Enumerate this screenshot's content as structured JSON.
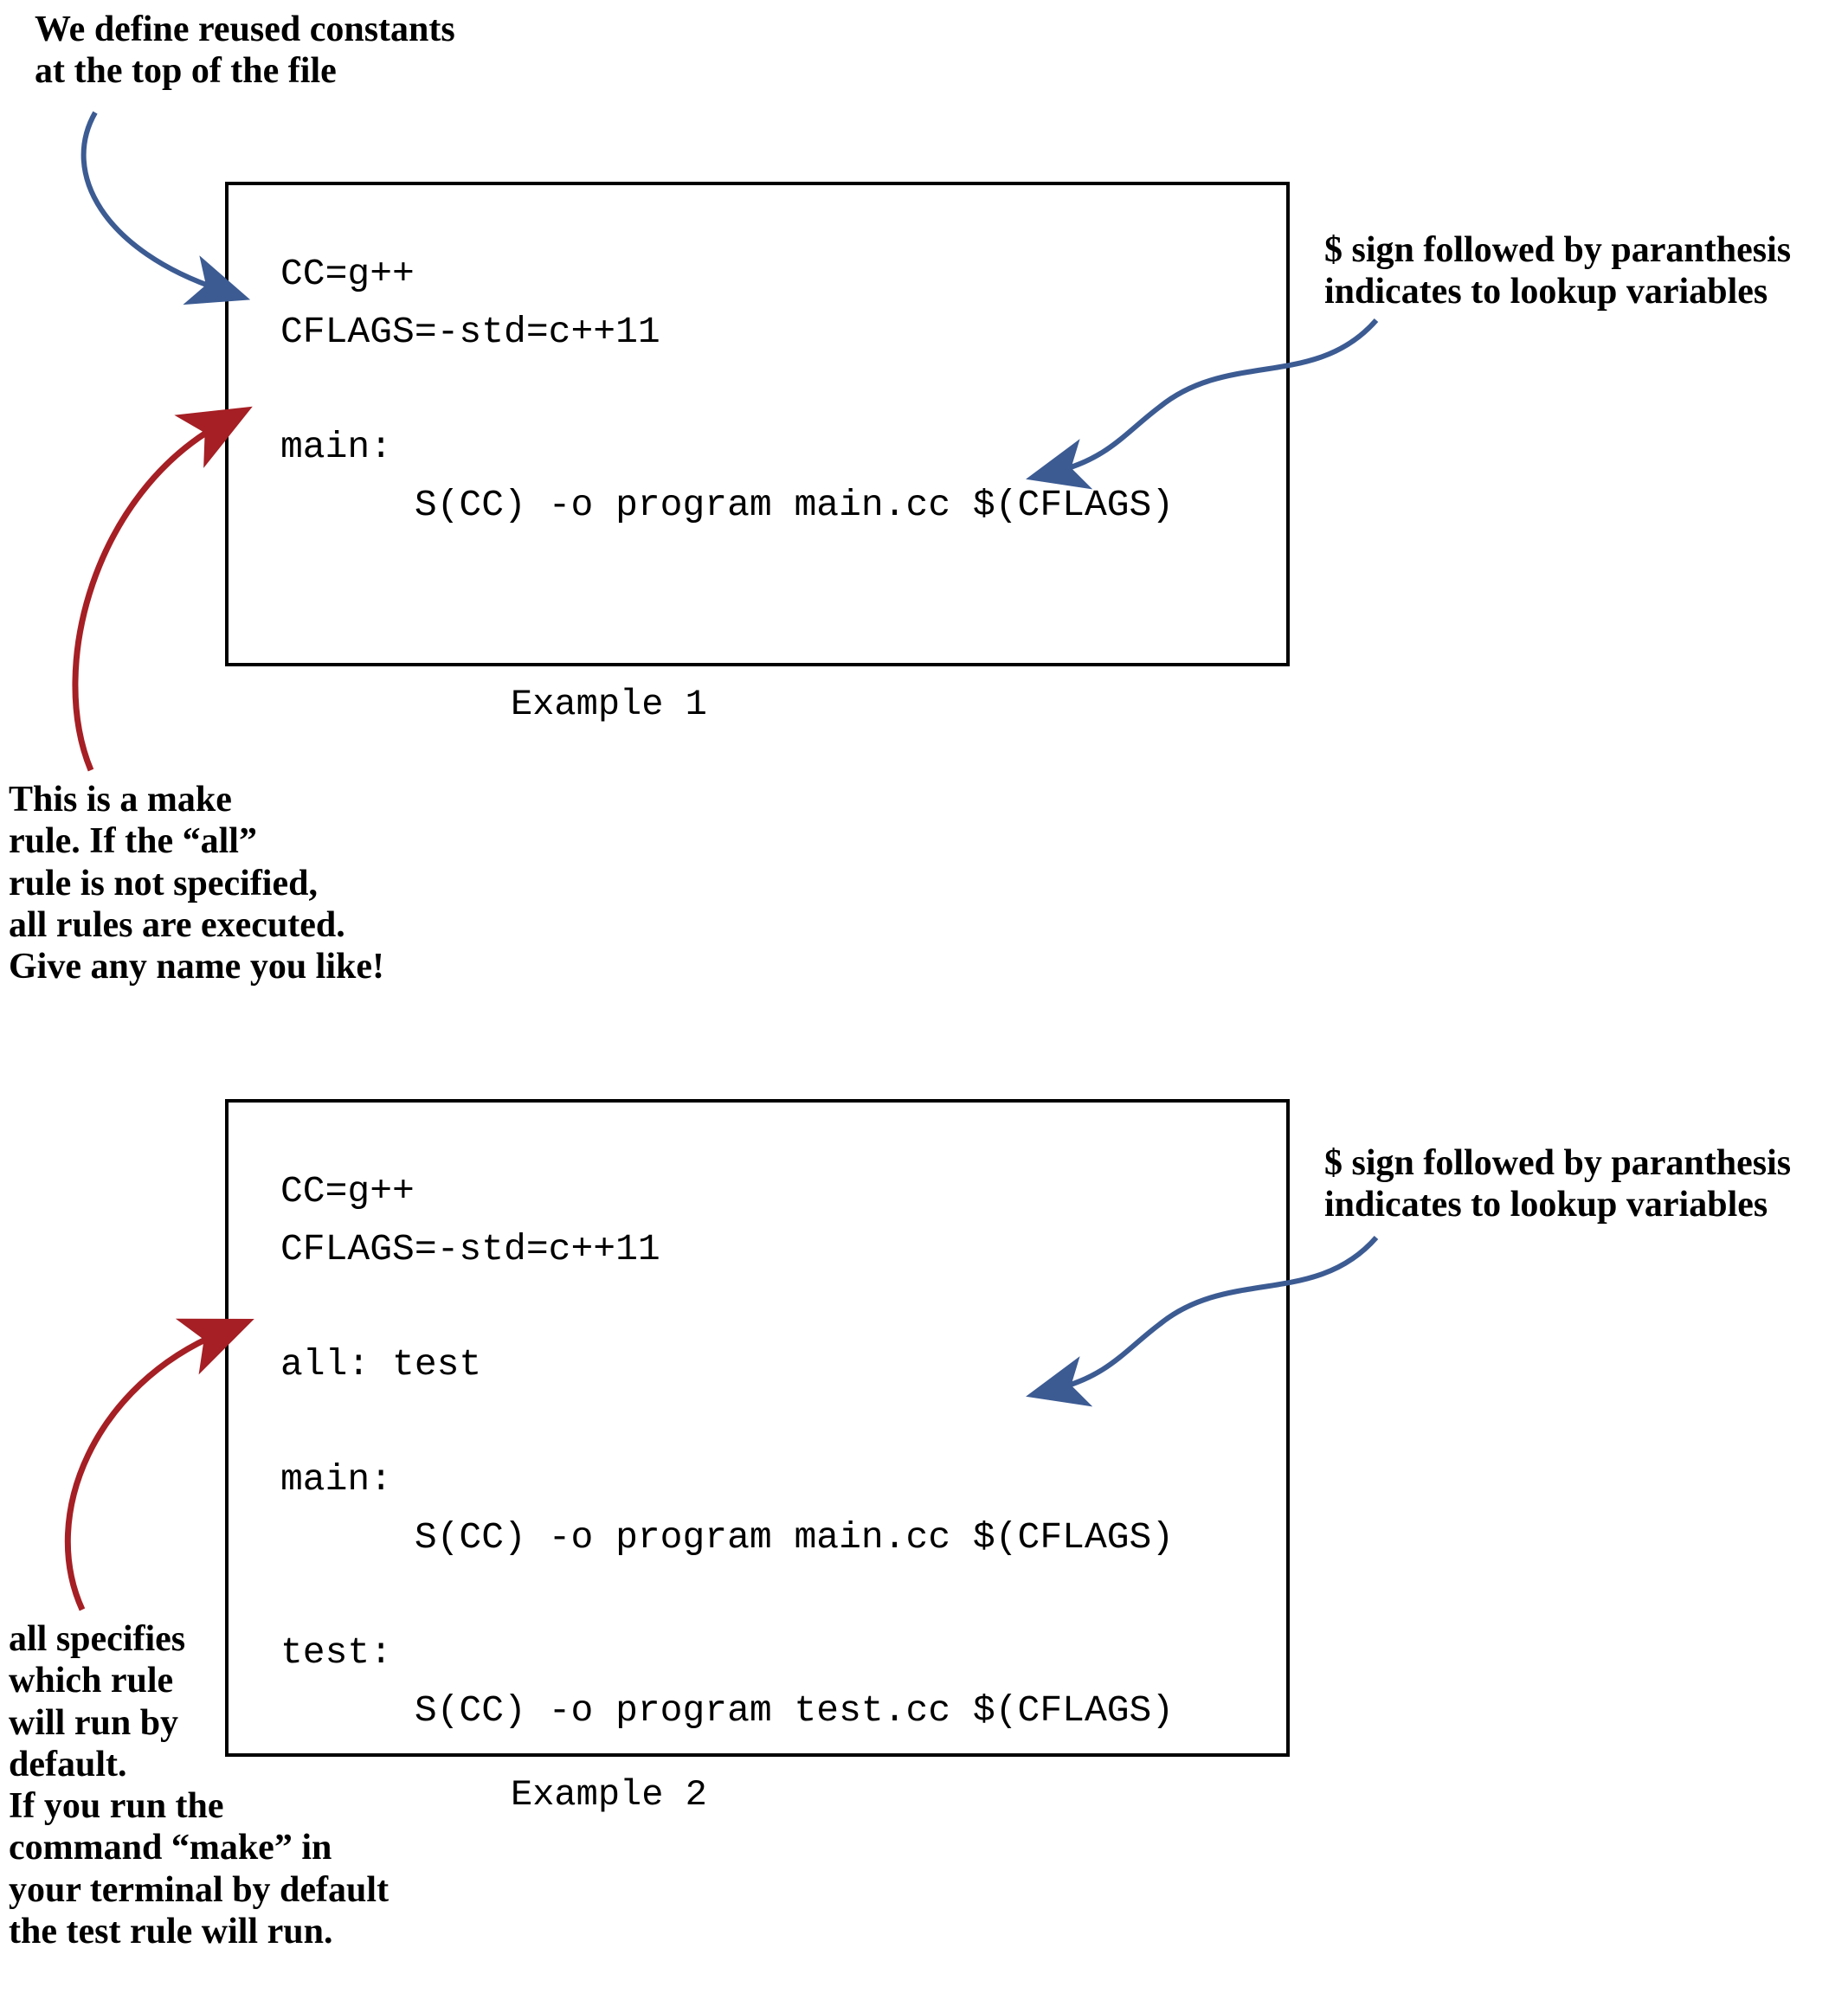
{
  "annotations": {
    "top": "We define reused constants\nat the top of the file",
    "dollar1": "$ sign followed by paranthesis\nindicates to lookup variables",
    "makerule": "This is a make\nrule. If the “all”\nrule is not specified,\nall rules are executed.\nGive any name you like!",
    "dollar2": "$ sign followed by paranthesis\nindicates to lookup variables",
    "allrule": "all specifies\nwhich rule\nwill run by\ndefault.\nIf you run the\ncommand “make” in\nyour terminal by default\nthe test rule will run."
  },
  "example1": {
    "code": "CC=g++\nCFLAGS=-std=c++11\n\nmain:\n      S(CC) -o program main.cc $(CFLAGS)",
    "caption": "Example 1"
  },
  "example2": {
    "code": "CC=g++\nCFLAGS=-std=c++11\n\nall: test\n\nmain:\n      S(CC) -o program main.cc $(CFLAGS)\n\ntest:\n      S(CC) -o program test.cc $(CFLAGS)",
    "caption": "Example 2"
  },
  "colors": {
    "blue": "#3c5b93",
    "red": "#a51f24"
  }
}
